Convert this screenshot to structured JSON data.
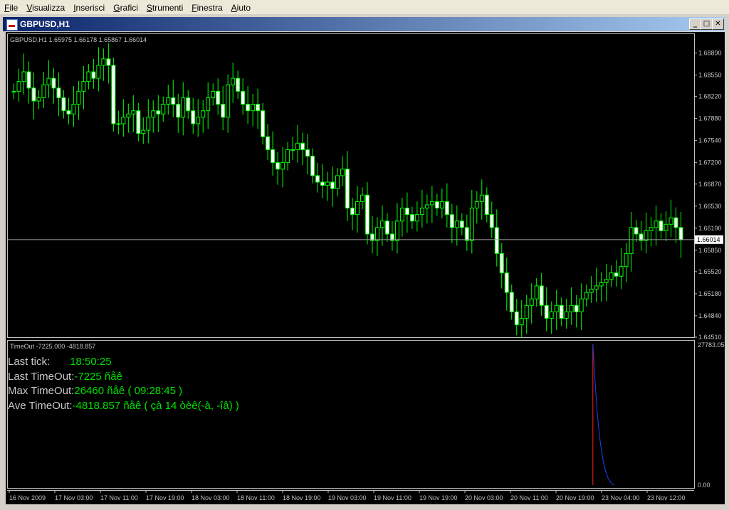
{
  "menu": [
    {
      "label": "File",
      "key": "F",
      "rest": "ile"
    },
    {
      "label": "Visualizza",
      "key": "V",
      "rest": "isualizza"
    },
    {
      "label": "Inserisci",
      "key": "I",
      "rest": "nserisci"
    },
    {
      "label": "Grafici",
      "key": "G",
      "rest": "rafici"
    },
    {
      "label": "Strumenti",
      "key": "S",
      "rest": "trumenti"
    },
    {
      "label": "Finestra",
      "key": "F",
      "rest": "inestra"
    },
    {
      "label": "Aiuto",
      "key": "A",
      "rest": "iuto"
    }
  ],
  "window": {
    "title": "GBPUSD,H1",
    "minimize": "_",
    "restore": "□",
    "close": "✕"
  },
  "main_chart": {
    "header": "GBPUSD,H1  1.65975 1.66178 1.65867 1.66014",
    "price_labels": [
      "1.68890",
      "1.68550",
      "1.68220",
      "1.67880",
      "1.67540",
      "1.67200",
      "1.66870",
      "1.66530",
      "1.66190",
      "1.65850",
      "1.65520",
      "1.65180",
      "1.64840",
      "1.64510"
    ],
    "current_price": "1.66014"
  },
  "indicator": {
    "header": "TimeOut -7225.000 -4818.857",
    "top_label": "27783.05",
    "bottom_label": "0.00",
    "rows": [
      {
        "label": "Last tick:",
        "value": "18:50:25"
      },
      {
        "label": "Last TimeOut:",
        "value": "-7225 ñåê"
      },
      {
        "label": "Max TimeOut:",
        "value": "26460 ñåê  ( 09:28:45 )"
      },
      {
        "label": "Ave TimeOut:",
        "value": "-4818.857 ñåê  ( çà 14 òèê(-à, -îâ)  )"
      }
    ]
  },
  "time_labels": [
    "16 Nov 2009",
    "17 Nov 03:00",
    "17 Nov 11:00",
    "17 Nov 19:00",
    "18 Nov 03:00",
    "18 Nov 11:00",
    "18 Nov 19:00",
    "19 Nov 03:00",
    "19 Nov 11:00",
    "19 Nov 19:00",
    "20 Nov 03:00",
    "20 Nov 11:00",
    "20 Nov 19:00",
    "23 Nov 04:00",
    "23 Nov 12:00"
  ],
  "chart_data": {
    "type": "candlestick",
    "symbol": "GBPUSD,H1",
    "ylim": [
      1.6451,
      1.6917
    ],
    "closes": [
      1.683,
      1.6845,
      1.686,
      1.6835,
      1.6815,
      1.682,
      1.684,
      1.685,
      1.6835,
      1.682,
      1.68,
      1.6795,
      1.681,
      1.683,
      1.6845,
      1.686,
      1.685,
      1.687,
      1.688,
      1.687,
      1.678,
      1.678,
      1.679,
      1.6795,
      1.68,
      1.6765,
      1.677,
      1.679,
      1.68,
      1.6795,
      1.681,
      1.682,
      1.681,
      1.679,
      1.682,
      1.68,
      1.678,
      1.679,
      1.68,
      1.682,
      1.683,
      1.681,
      1.679,
      1.684,
      1.685,
      1.683,
      1.681,
      1.68,
      1.681,
      1.68,
      1.676,
      1.674,
      1.672,
      1.671,
      1.672,
      1.674,
      1.674,
      1.675,
      1.674,
      1.673,
      1.67,
      1.669,
      1.6685,
      1.669,
      1.668,
      1.67,
      1.671,
      1.665,
      1.664,
      1.666,
      1.667,
      1.661,
      1.66,
      1.662,
      1.663,
      1.661,
      1.66,
      1.663,
      1.665,
      1.664,
      1.663,
      1.664,
      1.665,
      1.6655,
      1.666,
      1.665,
      1.666,
      1.664,
      1.662,
      1.663,
      1.662,
      1.66,
      1.665,
      1.666,
      1.667,
      1.664,
      1.662,
      1.658,
      1.655,
      1.652,
      1.649,
      1.647,
      1.648,
      1.65,
      1.651,
      1.653,
      1.65,
      1.648,
      1.649,
      1.65,
      1.648,
      1.649,
      1.65,
      1.649,
      1.651,
      1.652,
      1.6525,
      1.653,
      1.6535,
      1.654,
      1.655,
      1.6545,
      1.656,
      1.658,
      1.662,
      1.661,
      1.66,
      1.6615,
      1.662,
      1.663,
      1.6615,
      1.6625,
      1.6635,
      1.662,
      1.6601
    ],
    "indicator_series": [
      {
        "name": "red",
        "x0": 0.8525,
        "values": [
          27783,
          0
        ]
      },
      {
        "name": "blue",
        "x0": 0.8525,
        "values": [
          27783,
          20500,
          14500,
          10000,
          6800,
          4400,
          2700,
          1500,
          700,
          250,
          0
        ]
      }
    ]
  }
}
